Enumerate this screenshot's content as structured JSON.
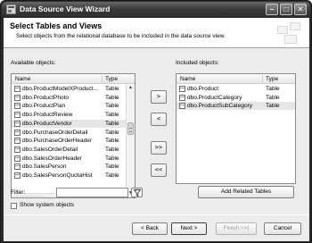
{
  "window": {
    "title": "Data Source View Wizard"
  },
  "header": {
    "title": "Select Tables and Views",
    "subtitle": "Select objects from the relational database to be included in the data source view."
  },
  "available": {
    "label": "Available objects:",
    "col_name": "Name",
    "col_type": "Type",
    "items": [
      {
        "name": "dbo.ProductModelXProduct...",
        "type": "Table"
      },
      {
        "name": "dbo.ProductPhoto",
        "type": "Table"
      },
      {
        "name": "dbo.ProductPlan",
        "type": "Table"
      },
      {
        "name": "dbo.ProductReview",
        "type": "Table"
      },
      {
        "name": "dbo.ProductVendor",
        "type": "Table",
        "selected": true
      },
      {
        "name": "dbo.PurchaseOrderDetail",
        "type": "Table"
      },
      {
        "name": "dbo.PurchaseOrderHeader",
        "type": "Table"
      },
      {
        "name": "dbo.SalesOrderDetail",
        "type": "Table"
      },
      {
        "name": "dbo.SalesOrderHeader",
        "type": "Table"
      },
      {
        "name": "dbo.SalesPerson",
        "type": "Table"
      },
      {
        "name": "dbo.SalesPersonQuotaHist",
        "type": "Table"
      }
    ]
  },
  "included": {
    "label": "Included objects:",
    "col_name": "Name",
    "col_type": "Type",
    "items": [
      {
        "name": "dbo.Product",
        "type": "Table"
      },
      {
        "name": "dbo.ProductCategory",
        "type": "Table"
      },
      {
        "name": "dbo.ProductSubCategory",
        "type": "Table",
        "selected": true
      }
    ]
  },
  "move_buttons": {
    "add": ">",
    "remove": "<",
    "add_all": ">>",
    "remove_all": "<<"
  },
  "filter": {
    "label": "Filter:",
    "value": ""
  },
  "show_system_objects": {
    "label": "Show system objects",
    "checked": false
  },
  "add_related_label": "Add Related Tables",
  "nav": {
    "back": "< Back",
    "next": "Next >",
    "finish": "Finish >>|",
    "cancel": "Cancel"
  }
}
